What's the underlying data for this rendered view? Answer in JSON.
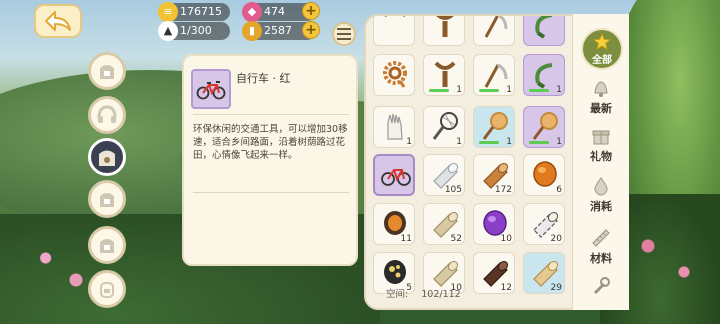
{
  "resources": {
    "gold": "176715",
    "gems": "474",
    "storage": "1/300",
    "coins": "2587"
  },
  "side_nav": {
    "items": [
      {
        "name": "side-locked-bag-1",
        "state": "locked"
      },
      {
        "name": "side-headphones",
        "state": "normal"
      },
      {
        "name": "side-bag-active",
        "state": "active"
      },
      {
        "name": "side-locked-bag-2",
        "state": "locked"
      },
      {
        "name": "side-locked-bag-3",
        "state": "locked"
      },
      {
        "name": "side-backpack",
        "state": "normal"
      }
    ]
  },
  "detail": {
    "name": "自行车 · 红",
    "description": "环保休闲的交通工具，可以增加30移速，适合乡间路面，沿着树荫路过花田，心情像飞起来一样。"
  },
  "inventory": {
    "space_label": "空间:",
    "space_value": "102/112",
    "items": [
      {
        "icon": "rope-icon",
        "count": "",
        "bg": "plain",
        "bar": false
      },
      {
        "icon": "slingshot-icon",
        "count": "",
        "bg": "plain",
        "bar": false
      },
      {
        "icon": "scythe-icon",
        "count": "",
        "bg": "plain",
        "bar": false
      },
      {
        "icon": "sickle-icon",
        "count": "",
        "bg": "purple",
        "bar": false
      },
      {
        "icon": "rope-coil-icon",
        "count": "",
        "bg": "plain",
        "bar": false
      },
      {
        "icon": "slingshot-icon",
        "count": "1",
        "bg": "plain",
        "bar": true
      },
      {
        "icon": "scythe-icon",
        "count": "1",
        "bg": "plain",
        "bar": true
      },
      {
        "icon": "sickle-icon",
        "count": "1",
        "bg": "purple",
        "bar": true
      },
      {
        "icon": "glove-icon",
        "count": "1",
        "bg": "plain",
        "bar": false
      },
      {
        "icon": "bug-net-icon",
        "count": "1",
        "bg": "plain",
        "bar": false
      },
      {
        "icon": "butterfly-net-icon",
        "count": "1",
        "bg": "blue",
        "bar": true
      },
      {
        "icon": "butterfly-net-icon",
        "count": "1",
        "bg": "purple",
        "bar": true
      },
      {
        "icon": "bicycle-icon",
        "count": "",
        "bg": "selected",
        "bar": false
      },
      {
        "icon": "stone-log-icon",
        "count": "105",
        "bg": "plain",
        "bar": false
      },
      {
        "icon": "wood-log-icon",
        "count": "172",
        "bg": "plain",
        "bar": false
      },
      {
        "icon": "amber-gem-icon",
        "count": "6",
        "bg": "plain",
        "bar": false
      },
      {
        "icon": "amber-stone-icon",
        "count": "11",
        "bg": "plain",
        "bar": false
      },
      {
        "icon": "pale-log-icon",
        "count": "52",
        "bg": "plain",
        "bar": false
      },
      {
        "icon": "purple-gem-icon",
        "count": "10",
        "bg": "plain",
        "bar": false
      },
      {
        "icon": "birch-log-icon",
        "count": "20",
        "bg": "plain",
        "bar": false
      },
      {
        "icon": "spotted-stone-icon",
        "count": "5",
        "bg": "plain",
        "bar": false
      },
      {
        "icon": "pale-log-icon",
        "count": "10",
        "bg": "plain",
        "bar": false
      },
      {
        "icon": "dark-log-icon",
        "count": "12",
        "bg": "plain",
        "bar": false
      },
      {
        "icon": "light-log-icon",
        "count": "29",
        "bg": "blue",
        "bar": false
      }
    ]
  },
  "tabs": [
    {
      "id": "all",
      "label": "全部",
      "icon": "star-icon",
      "active": true
    },
    {
      "id": "new",
      "label": "最新",
      "icon": "bell-icon",
      "active": false
    },
    {
      "id": "gift",
      "label": "礼物",
      "icon": "gift-icon",
      "active": false
    },
    {
      "id": "consumable",
      "label": "消耗",
      "icon": "drop-icon",
      "active": false
    },
    {
      "id": "material",
      "label": "材料",
      "icon": "ruler-icon",
      "active": false
    },
    {
      "id": "tool",
      "label": "",
      "icon": "tool-icon",
      "active": false
    }
  ],
  "colors": {
    "panel_bg": "#f4eee0",
    "selected_slot": "#d7c6e8",
    "active_tab": "#7b8f3f",
    "plus_button": "#f3c53a"
  }
}
